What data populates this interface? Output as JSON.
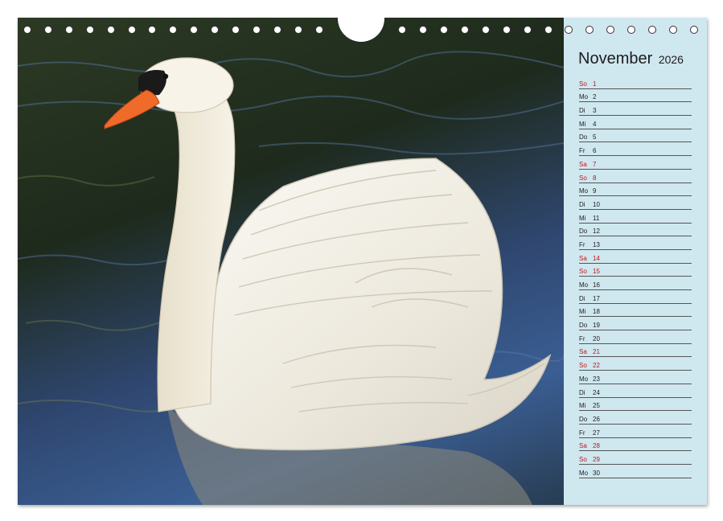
{
  "calendar": {
    "month": "November",
    "year": "2026",
    "days": [
      {
        "wd": "So",
        "n": "1",
        "red": true
      },
      {
        "wd": "Mo",
        "n": "2",
        "red": false
      },
      {
        "wd": "Di",
        "n": "3",
        "red": false
      },
      {
        "wd": "Mi",
        "n": "4",
        "red": false
      },
      {
        "wd": "Do",
        "n": "5",
        "red": false
      },
      {
        "wd": "Fr",
        "n": "6",
        "red": false
      },
      {
        "wd": "Sa",
        "n": "7",
        "red": true
      },
      {
        "wd": "So",
        "n": "8",
        "red": true
      },
      {
        "wd": "Mo",
        "n": "9",
        "red": false
      },
      {
        "wd": "Di",
        "n": "10",
        "red": false
      },
      {
        "wd": "Mi",
        "n": "11",
        "red": false
      },
      {
        "wd": "Do",
        "n": "12",
        "red": false
      },
      {
        "wd": "Fr",
        "n": "13",
        "red": false
      },
      {
        "wd": "Sa",
        "n": "14",
        "red": true
      },
      {
        "wd": "So",
        "n": "15",
        "red": true
      },
      {
        "wd": "Mo",
        "n": "16",
        "red": false
      },
      {
        "wd": "Di",
        "n": "17",
        "red": false
      },
      {
        "wd": "Mi",
        "n": "18",
        "red": false
      },
      {
        "wd": "Do",
        "n": "19",
        "red": false
      },
      {
        "wd": "Fr",
        "n": "20",
        "red": false
      },
      {
        "wd": "Sa",
        "n": "21",
        "red": true
      },
      {
        "wd": "So",
        "n": "22",
        "red": true
      },
      {
        "wd": "Mo",
        "n": "23",
        "red": false
      },
      {
        "wd": "Di",
        "n": "24",
        "red": false
      },
      {
        "wd": "Mi",
        "n": "25",
        "red": false
      },
      {
        "wd": "Do",
        "n": "26",
        "red": false
      },
      {
        "wd": "Fr",
        "n": "27",
        "red": false
      },
      {
        "wd": "Sa",
        "n": "28",
        "red": true
      },
      {
        "wd": "So",
        "n": "29",
        "red": true
      },
      {
        "wd": "Mo",
        "n": "30",
        "red": false
      }
    ]
  },
  "colors": {
    "panel": "#cfe7ef",
    "weekend_text": "#c0161b",
    "water_blue": "#3a5e93",
    "swan_white": "#f4f1e8",
    "beak_orange": "#f06a2a"
  },
  "photo": {
    "subject": "swan-photo"
  }
}
